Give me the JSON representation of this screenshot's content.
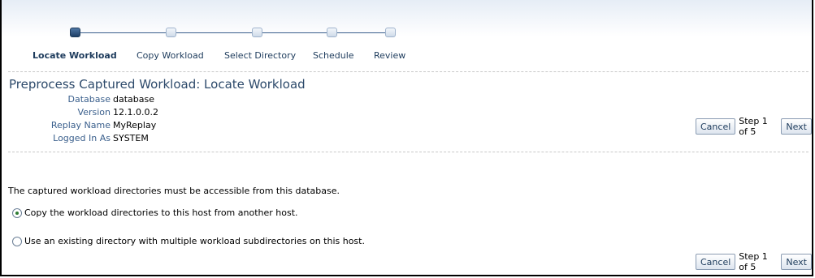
{
  "train": {
    "steps": [
      {
        "label": "Locate Workload",
        "state": "current"
      },
      {
        "label": "Copy Workload",
        "state": "todo"
      },
      {
        "label": "Select Directory",
        "state": "todo"
      },
      {
        "label": "Schedule",
        "state": "todo"
      },
      {
        "label": "Review",
        "state": "todo"
      }
    ]
  },
  "header": {
    "title": "Preprocess Captured Workload: Locate Workload",
    "info": [
      {
        "label": "Database",
        "value": "database"
      },
      {
        "label": "Version",
        "value": "12.1.0.0.2"
      },
      {
        "label": "Replay Name",
        "value": "MyReplay"
      },
      {
        "label": "Logged In As",
        "value": "SYSTEM"
      }
    ]
  },
  "nav": {
    "cancel_label": "Cancel",
    "step_text": "Step 1 of 5",
    "next_label": "Next"
  },
  "content": {
    "message": "The captured workload directories must be accessible from this database.",
    "options": [
      {
        "label": "Copy the workload directories to this host from another host.",
        "checked": true
      },
      {
        "label": "Use an existing directory with multiple workload subdirectories on this host.",
        "checked": false
      }
    ]
  }
}
